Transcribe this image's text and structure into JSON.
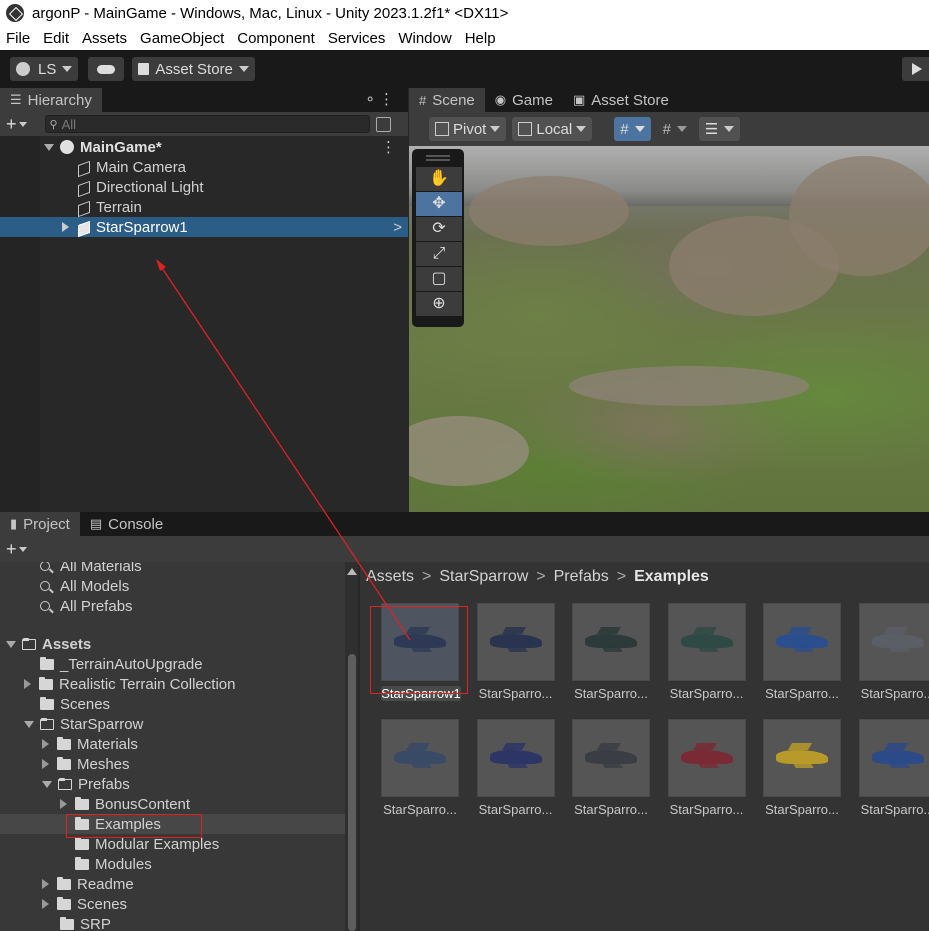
{
  "window": {
    "title": "argonP - MainGame - Windows, Mac, Linux - Unity 2023.1.2f1* <DX11>"
  },
  "menu": [
    "File",
    "Edit",
    "Assets",
    "GameObject",
    "Component",
    "Services",
    "Window",
    "Help"
  ],
  "toolbar": {
    "account": "LS",
    "asset_store": "Asset Store"
  },
  "hierarchy": {
    "tab": "Hierarchy",
    "search_placeholder": "All",
    "scene_name": "MainGame*",
    "items": [
      "Main Camera",
      "Directional Light",
      "Terrain",
      "StarSparrow1"
    ],
    "selected": "StarSparrow1"
  },
  "scene_view": {
    "tabs": [
      "Scene",
      "Game",
      "Asset Store"
    ],
    "pivot": "Pivot",
    "space": "Local",
    "tools": [
      "hand-tool",
      "move-tool",
      "rotate-tool",
      "scale-tool",
      "rect-tool",
      "transform-tool"
    ],
    "active_tool": "move-tool"
  },
  "project": {
    "tabs": [
      "Project",
      "Console"
    ],
    "favorites": [
      "All Materials",
      "All Models",
      "All Prefabs"
    ],
    "tree": {
      "root": "Assets",
      "items": [
        {
          "label": "_TerrainAutoUpgrade"
        },
        {
          "label": "Realistic Terrain Collection"
        },
        {
          "label": "Scenes"
        },
        {
          "label": "StarSparrow"
        },
        {
          "label": "Materials"
        },
        {
          "label": "Meshes"
        },
        {
          "label": "Prefabs"
        },
        {
          "label": "BonusContent"
        },
        {
          "label": "Examples"
        },
        {
          "label": "Modular Examples"
        },
        {
          "label": "Modules"
        },
        {
          "label": "Readme"
        },
        {
          "label": "Scenes"
        },
        {
          "label": "SRP"
        }
      ]
    },
    "breadcrumb": [
      "Assets",
      "StarSparrow",
      "Prefabs",
      "Examples"
    ],
    "assets": [
      {
        "label": "StarSparrow1",
        "color": "#2e3a55"
      },
      {
        "label": "StarSparro...",
        "color": "#2a3450"
      },
      {
        "label": "StarSparro...",
        "color": "#2c3a3a"
      },
      {
        "label": "StarSparro...",
        "color": "#2f4a45"
      },
      {
        "label": "StarSparro...",
        "color": "#2b4e8e"
      },
      {
        "label": "StarSparro...",
        "color": "#5a5f66"
      },
      {
        "label": "StarSparro...",
        "color": "#384a66"
      },
      {
        "label": "StarSparro...",
        "color": "#2d3566"
      },
      {
        "label": "StarSparro...",
        "color": "#3a3d44"
      },
      {
        "label": "StarSparro...",
        "color": "#7a2a34"
      },
      {
        "label": "StarSparro...",
        "color": "#b89a2a"
      },
      {
        "label": "StarSparro...",
        "color": "#2c4a88"
      }
    ]
  },
  "colors": {
    "selection": "#2c5d87",
    "annotation": "#dd2222"
  }
}
